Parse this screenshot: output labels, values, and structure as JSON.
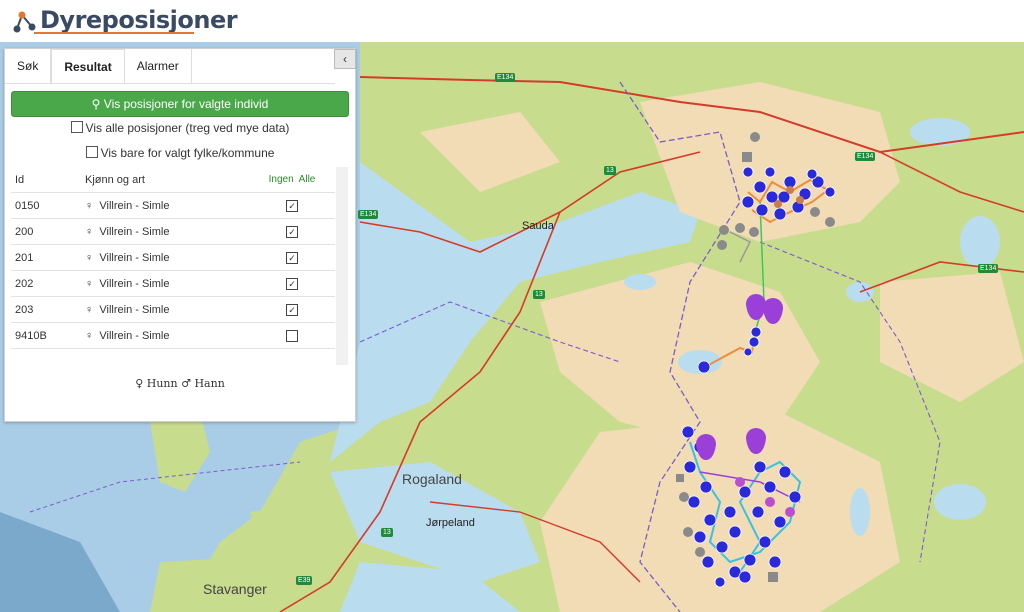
{
  "app": {
    "title": "Dyreposisjoner"
  },
  "panel": {
    "tabs": [
      "Søk",
      "Resultat",
      "Alarmer"
    ],
    "active_tab": "Resultat",
    "show_button_label": "Vis posisjoner for valgte individ",
    "show_all_label": "Vis alle posisjoner (treg ved mye data)",
    "filter_label": "Vis bare for valgt fylke/kommune",
    "table": {
      "col_id": "Id",
      "col_species": "Kjønn og art",
      "col_none": "Ingen",
      "col_all": "Alle",
      "rows": [
        {
          "id": "0150",
          "sex": "♀",
          "species": "Villrein - Simle",
          "checked": true
        },
        {
          "id": "200",
          "sex": "♀",
          "species": "Villrein - Simle",
          "checked": true
        },
        {
          "id": "201",
          "sex": "♀",
          "species": "Villrein - Simle",
          "checked": true
        },
        {
          "id": "202",
          "sex": "♀",
          "species": "Villrein - Simle",
          "checked": true
        },
        {
          "id": "203",
          "sex": "♀",
          "species": "Villrein - Simle",
          "checked": true
        },
        {
          "id": "9410B",
          "sex": "♀",
          "species": "Villrein - Simle",
          "checked": false
        }
      ]
    },
    "legend": "♀ Hunn ♂ Hann"
  },
  "map": {
    "places": [
      "Sauda",
      "Rogaland",
      "Jørpeland",
      "Stavanger"
    ],
    "roads": [
      "E134",
      "E134",
      "E134",
      "E134",
      "13",
      "13",
      "13",
      "E39"
    ],
    "colors": {
      "land": "#f1dcb6",
      "forest": "#c8dc8e",
      "water": "#b9dcef",
      "sea": "#a7cde6",
      "road": "#d53a2a"
    }
  }
}
